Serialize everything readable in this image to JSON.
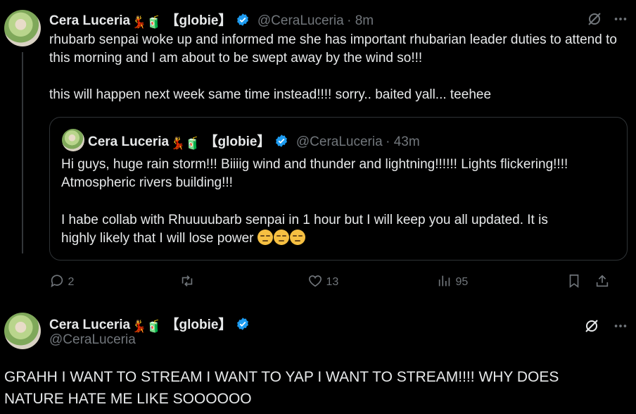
{
  "tweet1": {
    "display_name": "Cera Luceria",
    "name_emojis": "💃🧃",
    "name_suffix": "【globie】",
    "handle": "@CeraLuceria",
    "time": "· 8m",
    "text": "rhubarb senpai woke up and informed me she has important rhubarian leader duties to attend to this morning and I am about to be swept away by the wind so!!!\n\nthis will happen next week same time instead!!!! sorry.. baited yall... teehee",
    "quote": {
      "display_name": "Cera Luceria",
      "name_emojis": "💃🧃",
      "name_suffix": "【globie】",
      "handle": "@CeraLuceria",
      "time": "· 43m",
      "text_p1": "Hi guys, huge rain storm!!! Biiiig wind and thunder and lightning!!!!!! Lights flickering!!!!\nAtmospheric rivers building!!!",
      "text_p2": "I habe collab with Rhuuuubarb senpai in 1 hour but I will keep you all updated. It is\nhighly likely that I will lose power"
    },
    "actions": {
      "replies": "2",
      "reposts": "",
      "likes": "13",
      "views": "95"
    }
  },
  "tweet2": {
    "display_name": "Cera Luceria",
    "name_emojis": "💃🧃",
    "name_suffix": "【globie】",
    "handle": "@CeraLuceria",
    "text": "GRAHH I WANT TO STREAM I WANT TO YAP I WANT TO STREAM!!!! WHY DOES\nNATURE HATE ME LIKE SOOOOOO"
  },
  "icons": {
    "more": "more-horizontal-icon",
    "grok": "grok-icon",
    "reply": "reply-icon",
    "repost": "repost-icon",
    "like": "heart-icon",
    "views": "views-icon",
    "bookmark": "bookmark-icon",
    "share": "share-icon"
  },
  "colors": {
    "verified": "#1d9bf0",
    "muted": "#71767b",
    "border": "#2f3336"
  }
}
